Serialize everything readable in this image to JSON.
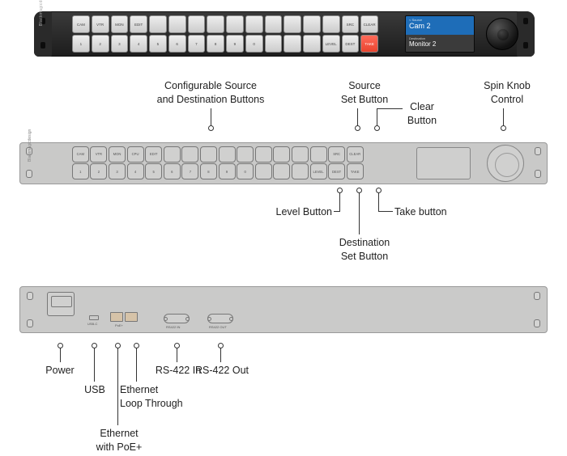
{
  "brand": "Blackmagicdesign",
  "dark": {
    "top_row": [
      "CAM",
      "VTR",
      "MON",
      "EDIT",
      "",
      "",
      "",
      "",
      "",
      "",
      "",
      "",
      "",
      "",
      "SRC",
      "CLEAR"
    ],
    "bot_row": [
      "1",
      "2",
      "3",
      "4",
      "5",
      "6",
      "7",
      "8",
      "9",
      "0",
      "",
      "",
      "",
      "LEVEL",
      "DEST",
      "TAKE"
    ],
    "lcd": {
      "hint1": "< Source",
      "val1": "Cam 2",
      "hint2": "Destination",
      "val2": "Monitor 2"
    }
  },
  "light": {
    "top_row": [
      "CAM",
      "VTR",
      "MON",
      "CPU",
      "EDIT",
      "",
      "",
      "",
      "",
      "",
      "",
      "",
      "",
      "",
      "SRC",
      "CLEAR"
    ],
    "bot_row": [
      "1",
      "2",
      "3",
      "4",
      "5",
      "6",
      "7",
      "8",
      "9",
      "0",
      "",
      "",
      "",
      "LEVEL",
      "DEST",
      "TAKE"
    ]
  },
  "back": {
    "usb": "USB-C",
    "eth": "PoE+",
    "rs1": "RS422 IN",
    "rs2": "RS422 OUT"
  },
  "callouts": {
    "cfg": "Configurable Source\nand Destination Buttons",
    "src": "Source\nSet Button",
    "clear": "Clear\nButton",
    "knob": "Spin Knob\nControl",
    "level": "Level Button",
    "dest": "Destination\nSet Button",
    "take": "Take button",
    "power": "Power",
    "usb": "USB",
    "ethpoe": "Ethernet\nwith PoE+",
    "ethloop": "Ethernet\nLoop Through",
    "rsin": "RS-422 In",
    "rsout": "RS-422 Out"
  }
}
